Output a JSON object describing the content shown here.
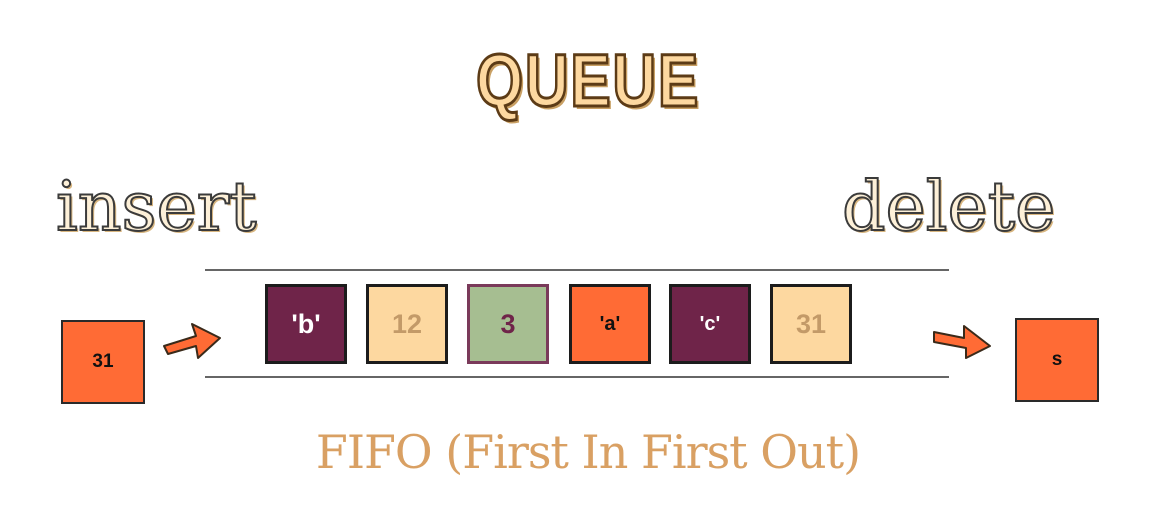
{
  "title": "QUEUE",
  "insert_label": "insert",
  "delete_label": "delete",
  "queue_cells": [
    {
      "label": "'b'",
      "fill": "#6f2449",
      "text_color": "#ffffff"
    },
    {
      "label": "12",
      "fill": "#fdd8a0",
      "text_color": "#c39a68"
    },
    {
      "label": "3",
      "fill": "#a6be91",
      "text_color": "#6f2449"
    },
    {
      "label": "'a'",
      "fill": "#ff6b35",
      "text_color": "#111111"
    },
    {
      "label": "'c'",
      "fill": "#6f2449",
      "text_color": "#ffffff"
    },
    {
      "label": "31",
      "fill": "#fdd8a0",
      "text_color": "#c39a68"
    }
  ],
  "incoming_value": "31",
  "outgoing_value": "s",
  "fifo_caption": "FIFO (First In First Out)",
  "colors": {
    "title_fill": "#fdd8a0",
    "label_fill": "#fdf0d8",
    "end_box_fill": "#ff6b35",
    "arrow_fill": "#ff6b35",
    "caption": "#d9a063",
    "rail": "#666666"
  }
}
